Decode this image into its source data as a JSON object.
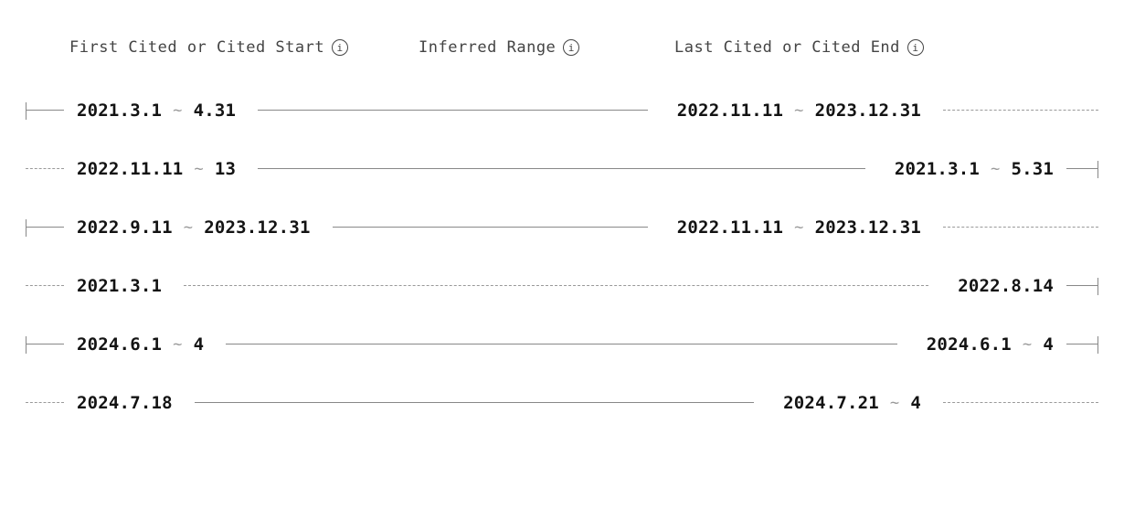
{
  "headers": {
    "first": "First Cited or Cited Start",
    "mid": "Inferred Range",
    "last": "Last Cited or Cited End"
  },
  "rows": [
    {
      "left": {
        "a": "2021.3.1",
        "b": "4.31"
      },
      "right": {
        "a": "2022.11.11",
        "b": "2023.12.31"
      },
      "pre": "cap-solid",
      "mid": "solid",
      "post": "none",
      "tail": "dashed",
      "endcap": false
    },
    {
      "left": {
        "a": "2022.11.11",
        "b": "13"
      },
      "right": {
        "a": "2021.3.1",
        "b": "5.31"
      },
      "pre": "dashed",
      "mid": "solid",
      "post": "none",
      "tail": "none",
      "endcap": true
    },
    {
      "left": {
        "a": "2022.9.11",
        "b": "2023.12.31"
      },
      "right": {
        "a": "2022.11.11",
        "b": "2023.12.31"
      },
      "pre": "cap-solid",
      "mid": "solid",
      "post": "none",
      "tail": "dashed",
      "endcap": false
    },
    {
      "left": {
        "a": "2021.3.1",
        "b": null
      },
      "right": {
        "a": "2022.8.14",
        "b": null
      },
      "pre": "dashed",
      "mid": "dashed",
      "post": "none",
      "tail": "none",
      "endcap": true
    },
    {
      "left": {
        "a": "2024.6.1",
        "b": "4"
      },
      "right": {
        "a": "2024.6.1",
        "b": "4"
      },
      "pre": "cap-solid",
      "mid": "solid",
      "post": "none",
      "tail": "none",
      "endcap": true
    },
    {
      "left": {
        "a": "2024.7.18",
        "b": null
      },
      "right": {
        "a": "2024.7.21",
        "b": "4"
      },
      "pre": "dashed",
      "mid": "solid",
      "post": "none",
      "tail": "dashed",
      "endcap": false
    }
  ]
}
